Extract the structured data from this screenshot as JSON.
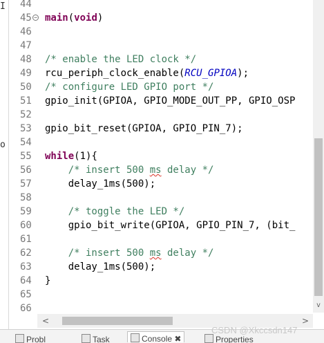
{
  "left_fragments": [
    "I",
    "o"
  ],
  "editor": {
    "lines": [
      {
        "n": "44",
        "code": ""
      },
      {
        "n": "45",
        "code": "main(void)",
        "fold": true
      },
      {
        "n": "46",
        "code": ""
      },
      {
        "n": "47",
        "code": ""
      },
      {
        "n": "48",
        "code": "/* enable the LED clock */"
      },
      {
        "n": "49",
        "code": "rcu_periph_clock_enable(RCU_GPIOA);"
      },
      {
        "n": "50",
        "code": "/* configure LED GPIO port */"
      },
      {
        "n": "51",
        "code": "gpio_init(GPIOA, GPIO_MODE_OUT_PP, GPIO_OSP"
      },
      {
        "n": "52",
        "code": ""
      },
      {
        "n": "53",
        "code": "gpio_bit_reset(GPIOA, GPIO_PIN_7);"
      },
      {
        "n": "54",
        "code": ""
      },
      {
        "n": "55",
        "code": "while(1){"
      },
      {
        "n": "56",
        "code": "    /* insert 500 ms delay */"
      },
      {
        "n": "57",
        "code": "    delay_1ms(500);"
      },
      {
        "n": "58",
        "code": ""
      },
      {
        "n": "59",
        "code": "    /* toggle the LED */"
      },
      {
        "n": "60",
        "code": "    gpio_bit_write(GPIOA, GPIO_PIN_7, (bit_"
      },
      {
        "n": "61",
        "code": ""
      },
      {
        "n": "62",
        "code": "    /* insert 500 ms delay */"
      },
      {
        "n": "63",
        "code": "    delay_1ms(500);"
      },
      {
        "n": "64",
        "code": "}"
      },
      {
        "n": "65",
        "code": ""
      },
      {
        "n": "66",
        "code": ""
      }
    ]
  },
  "scrollbars": {
    "left_arrow": "<",
    "right_arrow": ">",
    "down_arrow": "v"
  },
  "bottom_tabs": [
    {
      "label": "Probl"
    },
    {
      "label": "Task"
    },
    {
      "label": "Console ✖"
    },
    {
      "label": "Properties"
    }
  ],
  "watermark": "CSDN @Xkccsdn147",
  "colors": {
    "keyword": "#7f0055",
    "comment": "#3f7f5f",
    "constant": "#0000c0",
    "line_number": "#787878"
  }
}
